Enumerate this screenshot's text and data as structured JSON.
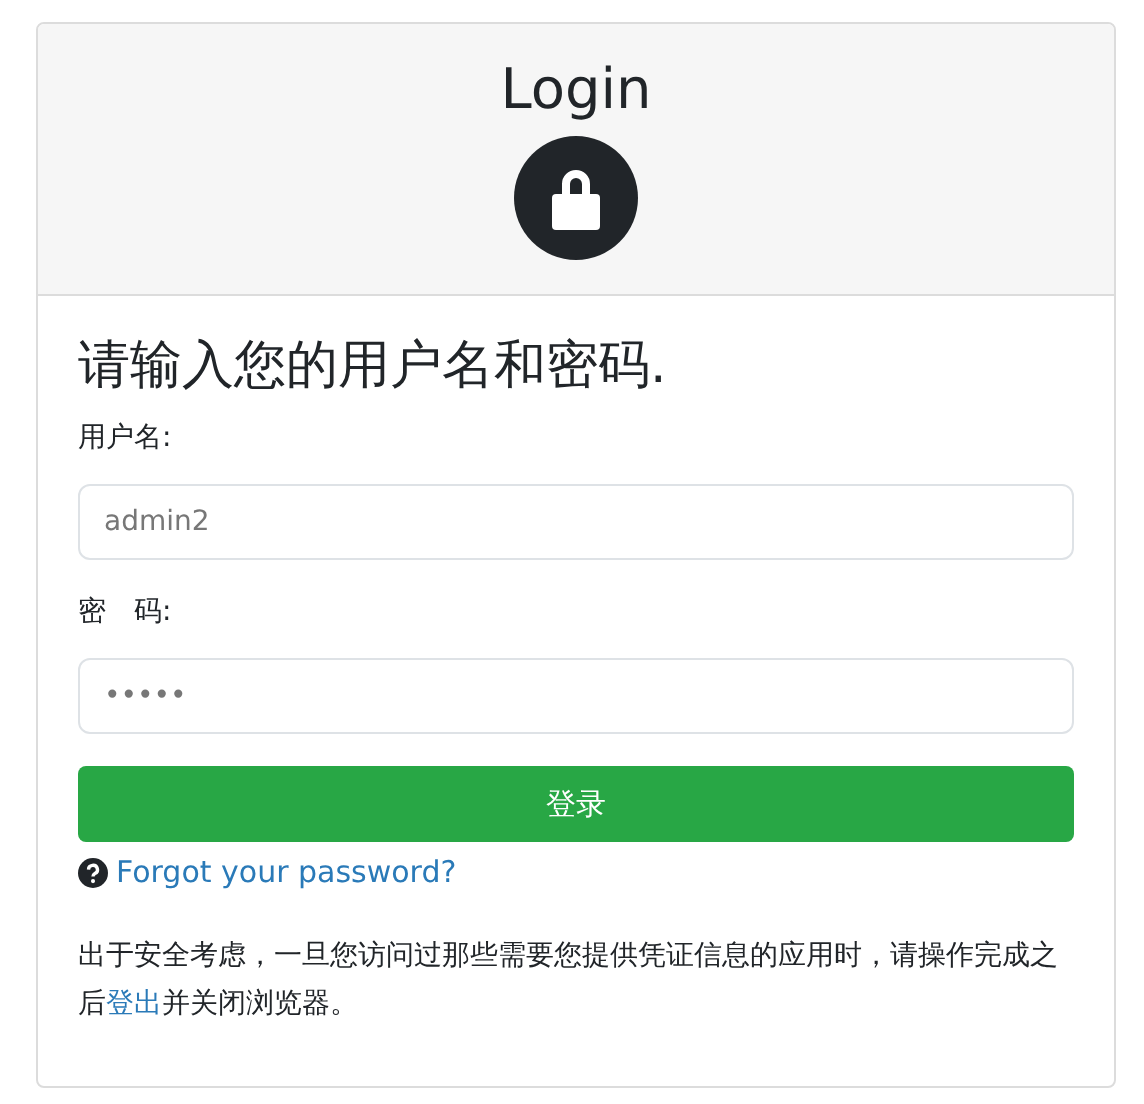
{
  "header": {
    "title": "Login"
  },
  "prompt": "请输入您的用户名和密码.",
  "fields": [
    {
      "label": "用户名:",
      "value": "admin2"
    },
    {
      "label": "密　码:",
      "value": "•••••"
    }
  ],
  "submit": "登录",
  "forgot_link": "Forgot your password?",
  "notice": {
    "before": "出于安全考虑，一旦您访问过那些需要您提供凭证信息的应用时，请操作完成之后",
    "link": "登出",
    "after": "并关闭浏览器。"
  }
}
